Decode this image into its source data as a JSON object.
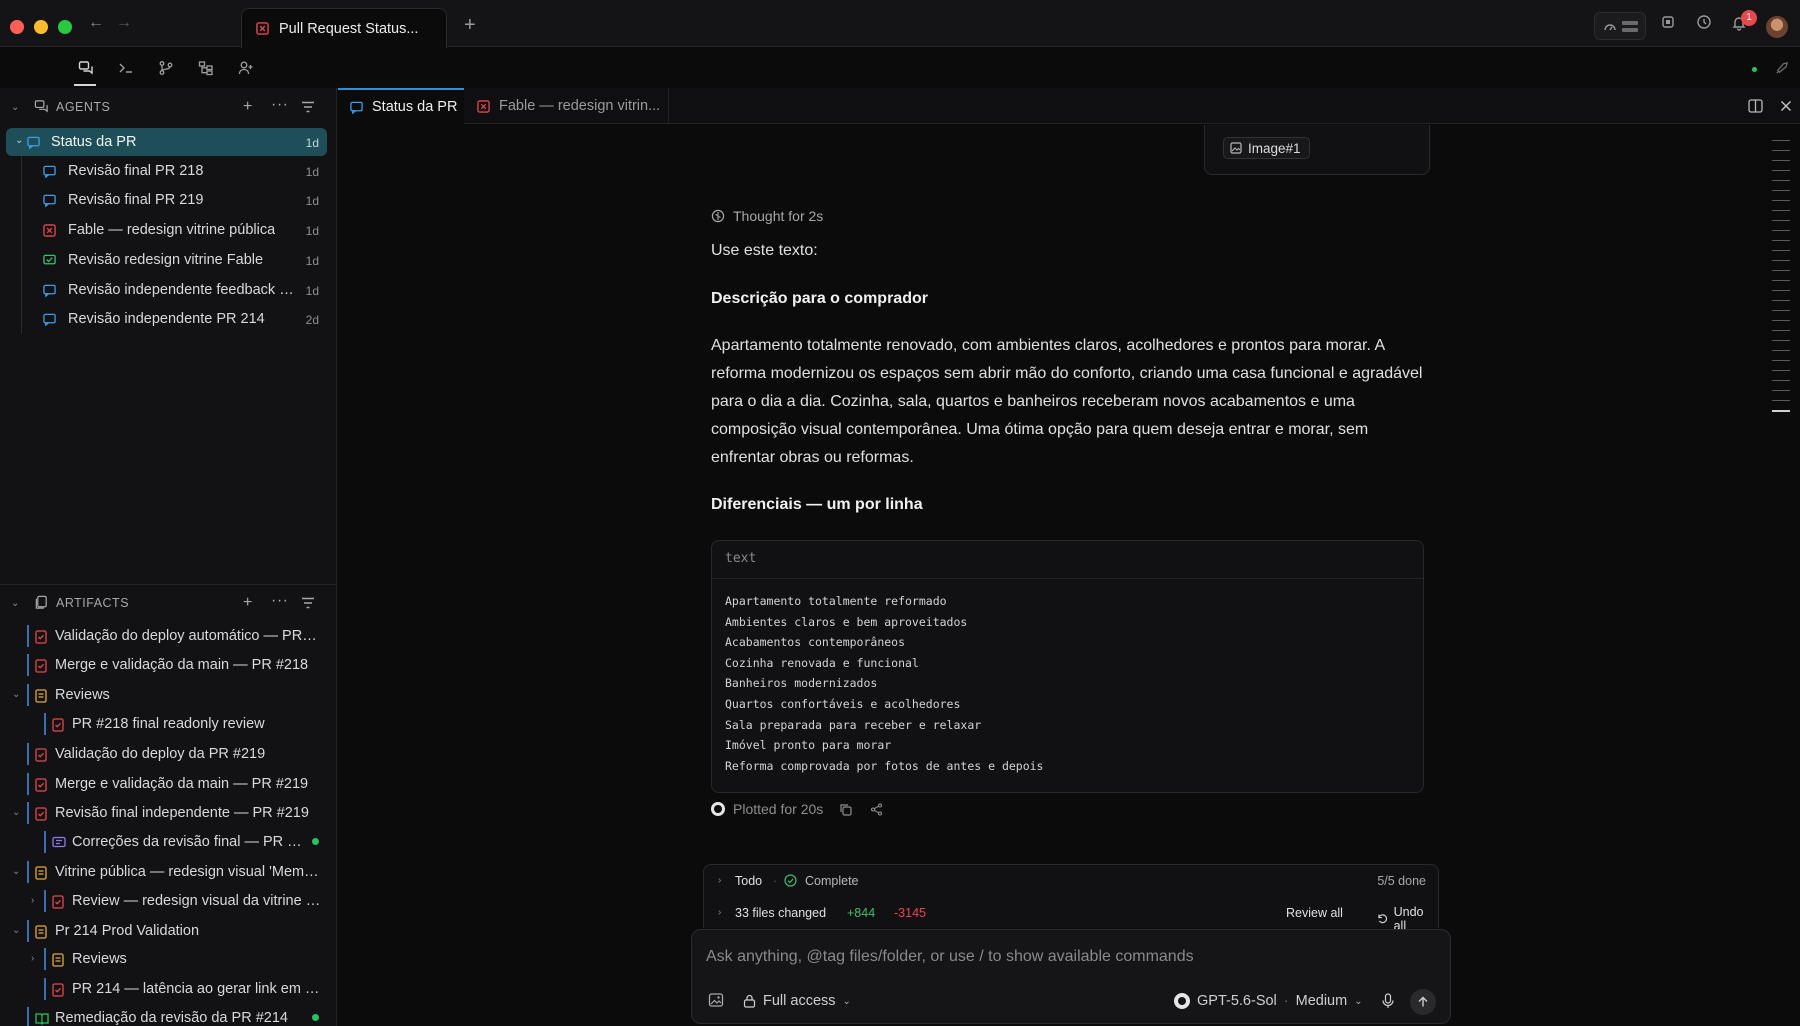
{
  "window": {
    "tab_title": "Pull Request Status..."
  },
  "notifications": {
    "count": "1"
  },
  "sidebar": {
    "agents_title": "AGENTS",
    "agents": [
      {
        "label": "Status da PR",
        "age": "1d",
        "icon": "chat-icon",
        "color": "#3b9ee8"
      },
      {
        "label": "Revisão final PR 218",
        "age": "1d",
        "icon": "chat-icon",
        "color": "#3b9ee8"
      },
      {
        "label": "Revisão final PR 219",
        "age": "1d",
        "icon": "chat-icon",
        "color": "#3b9ee8"
      },
      {
        "label": "Fable — redesign vitrine pública",
        "age": "1d",
        "icon": "error-icon",
        "color": "#e5484d"
      },
      {
        "label": "Revisão redesign vitrine Fable",
        "age": "1d",
        "icon": "check-chat-icon",
        "color": "#3fbf6a"
      },
      {
        "label": "Revisão independente feedback pu...",
        "age": "1d",
        "icon": "chat-icon",
        "color": "#3b9ee8"
      },
      {
        "label": "Revisão independente PR 214",
        "age": "2d",
        "icon": "chat-icon",
        "color": "#3b9ee8"
      }
    ],
    "artifacts_title": "ARTIFACTS",
    "artifacts": [
      {
        "label": "Validação do deploy automático — PR #..."
      },
      {
        "label": "Merge e validação da main — PR #218"
      },
      {
        "label": "Reviews"
      },
      {
        "label": "PR #218 final readonly review"
      },
      {
        "label": "Validação do deploy da PR #219"
      },
      {
        "label": "Merge e validação da main — PR #219"
      },
      {
        "label": "Revisão final independente — PR #219"
      },
      {
        "label": "Correções da revisão final — PR #219"
      },
      {
        "label": "Vitrine pública — redesign visual 'Memor..."
      },
      {
        "label": "Review — redesign visual da vitrine pú..."
      },
      {
        "label": "Pr 214 Prod Validation"
      },
      {
        "label": "Reviews"
      },
      {
        "label": "PR 214 — latência ao gerar link em pro..."
      },
      {
        "label": "Remediação da revisão da PR #214"
      }
    ]
  },
  "editor_tabs": [
    {
      "label": "Status da PR"
    },
    {
      "label": "Fable — redesign vitrin..."
    }
  ],
  "message": {
    "image_chip": "Image#1",
    "thought": "Thought for 2s",
    "intro": "Use este texto:",
    "heading1": "Descrição para o comprador",
    "paragraph": "Apartamento totalmente renovado, com ambientes claros, acolhedores e prontos para morar. A reforma modernizou os espaços sem abrir mão do conforto, criando uma casa funcional e agradável para o dia a dia. Cozinha, sala, quartos e banheiros receberam novos acabamentos e uma composição visual contemporânea. Uma ótima opção para quem deseja entrar e morar, sem enfrentar obras ou reformas.",
    "heading2": "Diferenciais — um por linha",
    "code_lang": "text",
    "code_lines": [
      "Apartamento totalmente reformado",
      "Ambientes claros e bem aproveitados",
      "Acabamentos contemporâneos",
      "Cozinha renovada e funcional",
      "Banheiros modernizados",
      "Quartos confortáveis e acolhedores",
      "Sala preparada para receber e relaxar",
      "Imóvel pronto para morar",
      "Reforma comprovada por fotos de antes e depois"
    ],
    "plotted": "Plotted for 20s"
  },
  "todo": {
    "label": "Todo",
    "status": "Complete",
    "progress": "5/5 done",
    "files_changed": "33 files changed",
    "additions": "+844",
    "deletions": "-3145",
    "review_all": "Review all",
    "undo_all": "Undo all"
  },
  "chat": {
    "placeholder": "Ask anything, @tag files/folder, or use / to show available commands",
    "access": "Full access",
    "model": "GPT-5.6-Sol",
    "effort": "Medium"
  },
  "colors": {
    "accent": "#2f8fd8",
    "selected_row": "#1e4f58",
    "artifact_red": "#e5484d",
    "folder_yellow": "#e2a93b",
    "success_green": "#22c55e"
  }
}
